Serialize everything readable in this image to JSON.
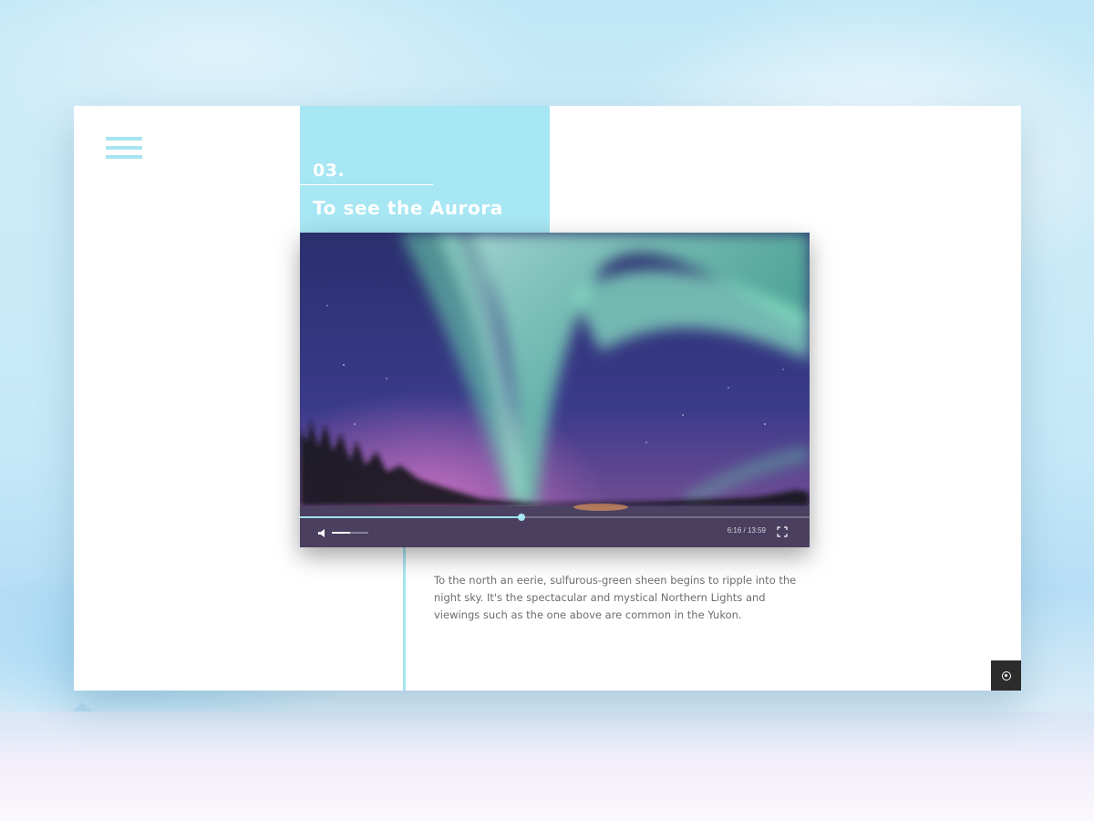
{
  "page": {
    "step_number": "03.",
    "title": "To see the Aurora",
    "description": "To the north an eerie, sulfurous-green sheen begins to ripple into the night sky. It's the spectacular and mystical Northern Lights and viewings such as the one above are common in the Yukon."
  },
  "video": {
    "current_time": "6:16",
    "duration": "13:59",
    "time_display": "6:16 / 13:59",
    "progress_fraction": 0.434,
    "volume_fraction": 0.5
  },
  "icons": {
    "menu": "hamburger-menu-icon",
    "volume": "speaker-icon",
    "fullscreen": "fullscreen-icon",
    "corner": "record-icon"
  },
  "colors": {
    "accent": "#a7e6f3",
    "corner_button": "#2c2c2c",
    "text": "#6d6d6d"
  }
}
